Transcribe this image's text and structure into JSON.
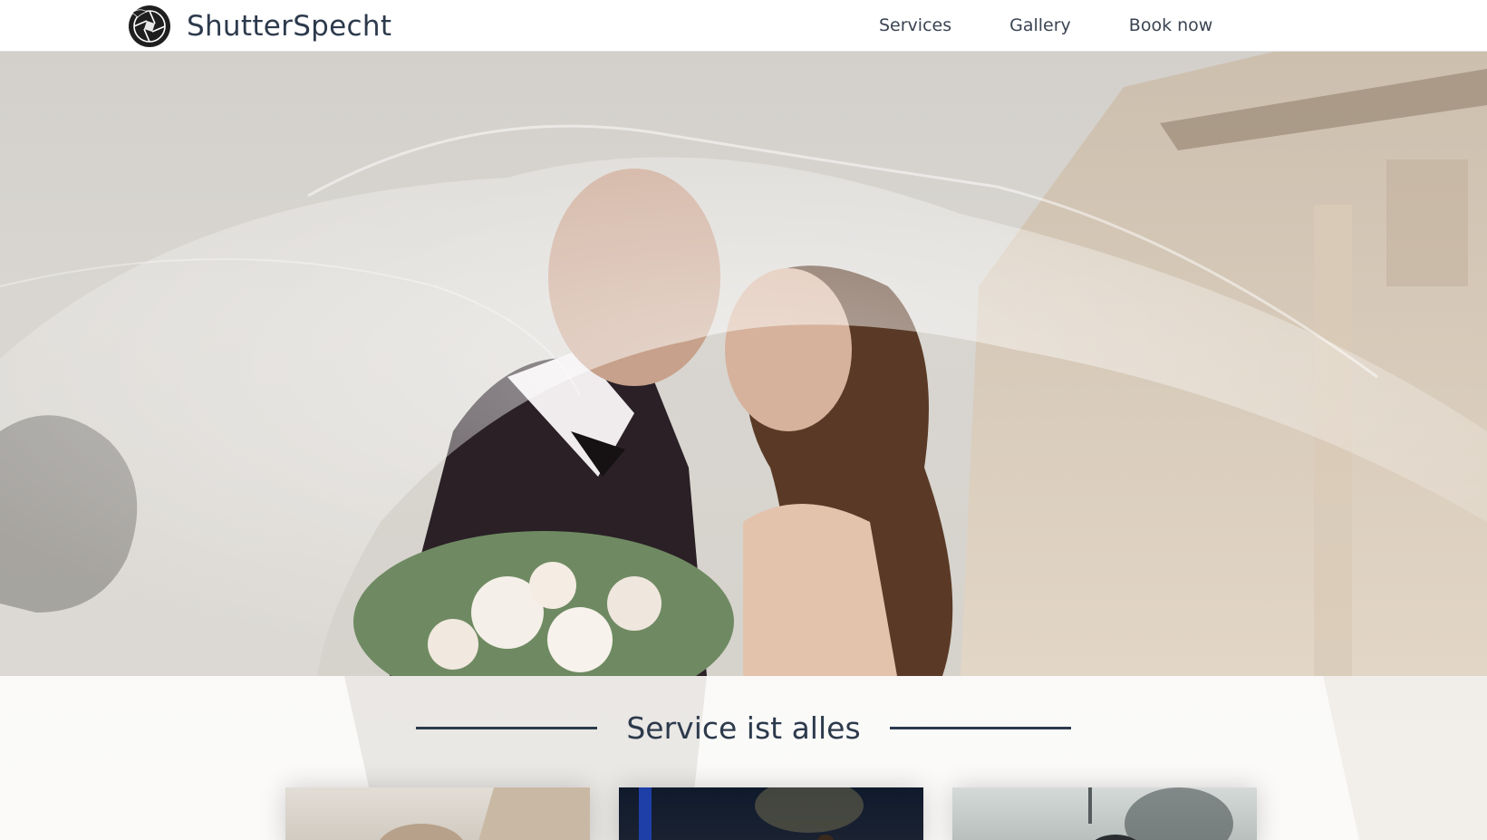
{
  "brand": {
    "name": "ShutterSpecht",
    "logo_icon": "camera-aperture-bird-icon"
  },
  "nav": {
    "items": [
      {
        "label": "Services"
      },
      {
        "label": "Gallery"
      },
      {
        "label": "Book now"
      }
    ]
  },
  "hero": {
    "image": "wedding-couple-kissing-under-veil-photo"
  },
  "services": {
    "title": "Service ist alles",
    "cards": [
      {
        "image": "wedding-photo-thumbnail"
      },
      {
        "image": "concert-stage-photo-thumbnail"
      },
      {
        "image": "smoke-portrait-photo-thumbnail"
      }
    ]
  },
  "colors": {
    "text_dark": "#2c3a4c",
    "nav_text": "#3a4452",
    "header_bg": "#ffffff",
    "section_bg": "#fbfaf9"
  }
}
